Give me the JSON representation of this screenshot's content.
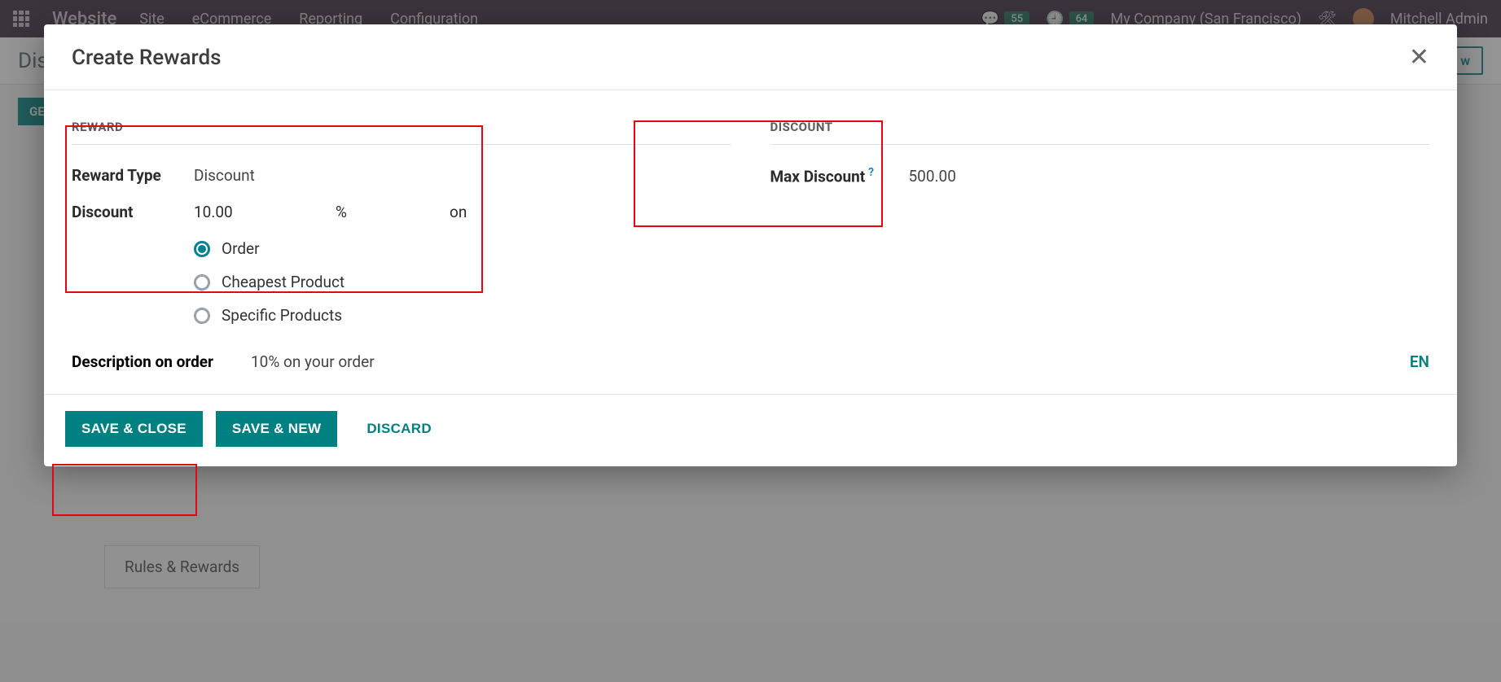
{
  "navbar": {
    "brand": "Website",
    "menu": [
      "Site",
      "eCommerce",
      "Reporting",
      "Configuration"
    ],
    "badge1": "55",
    "badge2": "64",
    "company": "My Company (San Francisco)",
    "user": "Mitchell Admin"
  },
  "subbar": {
    "title_partial": "Dis",
    "new_tail": "w",
    "green_btn": "GE"
  },
  "bottom_tab": "Rules & Rewards",
  "modal": {
    "title": "Create Rewards",
    "reward": {
      "section": "REWARD",
      "type_label": "Reward Type",
      "type_value": "Discount",
      "discount_label": "Discount",
      "amount": "10.00",
      "unit": "%",
      "on": "on",
      "options": {
        "order": "Order",
        "cheapest": "Cheapest Product",
        "specific": "Specific Products"
      }
    },
    "discount": {
      "section": "DISCOUNT",
      "max_label": "Max Discount",
      "max_value": "500.00",
      "q": "?"
    },
    "description": {
      "label": "Description on order",
      "value": "10% on your order",
      "lang": "EN"
    },
    "footer": {
      "save_close": "SAVE & CLOSE",
      "save_new": "SAVE & NEW",
      "discard": "DISCARD"
    }
  }
}
